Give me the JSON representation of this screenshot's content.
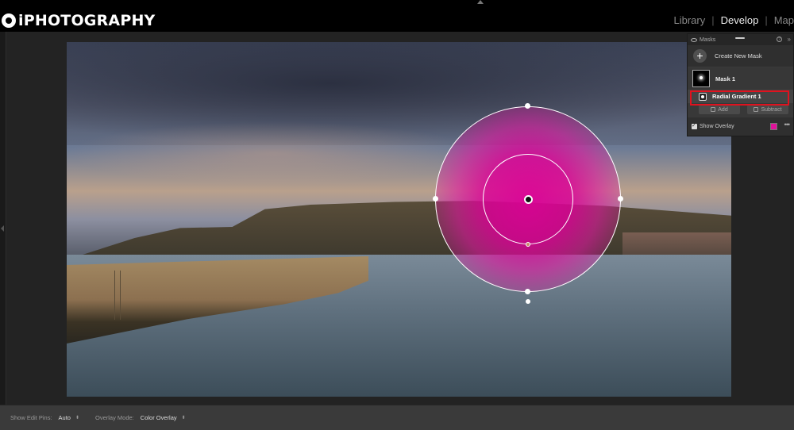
{
  "brand": {
    "name": "iPHOTOGRAPHY",
    "icon": "camera-lens-icon"
  },
  "modules": [
    {
      "label": "Library",
      "active": false
    },
    {
      "label": "Develop",
      "active": true
    },
    {
      "label": "Map",
      "active": false
    }
  ],
  "masks_panel": {
    "title": "Masks",
    "create_label": "Create New Mask",
    "mask_name": "Mask 1",
    "component_name": "Radial Gradient 1",
    "add_label": "Add",
    "subtract_label": "Subtract",
    "show_overlay_label": "Show Overlay",
    "show_overlay_checked": true,
    "overlay_color": "#e0129a",
    "highlight_color": "#e0121e"
  },
  "toolbar": {
    "edit_pins_label": "Show Edit Pins:",
    "edit_pins_value": "Auto",
    "overlay_mode_label": "Overlay Mode:",
    "overlay_mode_value": "Color Overlay"
  }
}
